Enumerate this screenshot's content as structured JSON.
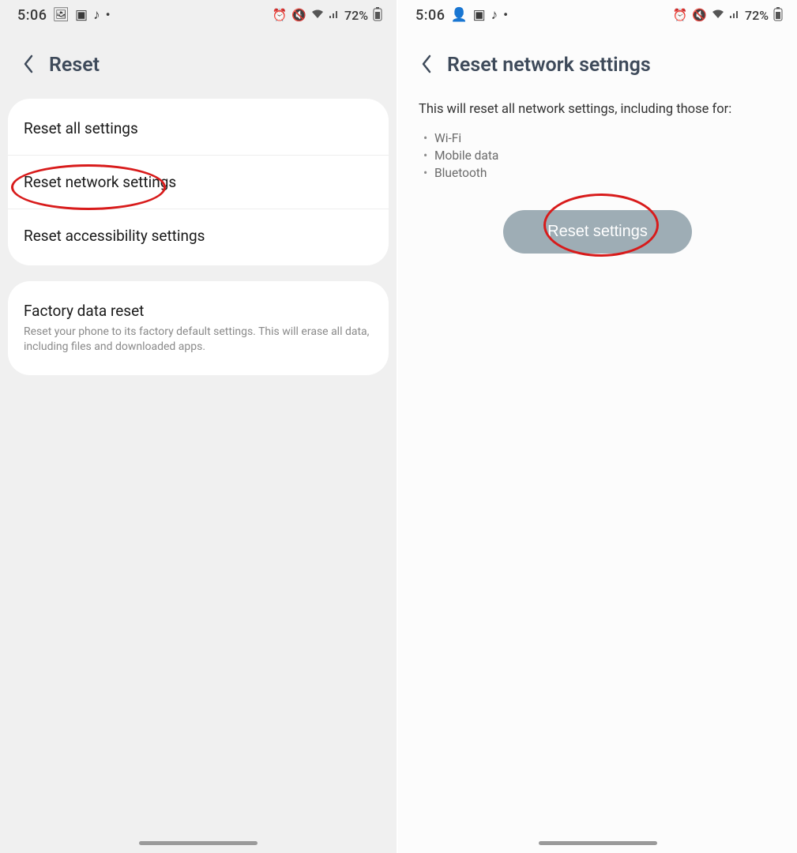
{
  "status": {
    "time": "5:06",
    "battery": "72%",
    "icons_left": [
      "image-icon",
      "apps-icon",
      "music-note-icon",
      "dot-icon"
    ],
    "icons_left_alt": [
      "profile-icon",
      "apps-icon",
      "music-note-icon",
      "dot-icon"
    ],
    "icons_right": [
      "alarm-icon",
      "mute-icon",
      "wifi-icon",
      "signal-icon"
    ]
  },
  "left": {
    "title": "Reset",
    "items": [
      {
        "label": "Reset all settings"
      },
      {
        "label": "Reset network settings"
      },
      {
        "label": "Reset accessibility settings"
      }
    ],
    "factory": {
      "label": "Factory data reset",
      "sub": "Reset your phone to its factory default settings. This will erase all data, including files and downloaded apps."
    }
  },
  "right": {
    "title": "Reset network settings",
    "intro": "This will reset all network settings, including those for:",
    "bullets": [
      "Wi-Fi",
      "Mobile data",
      "Bluetooth"
    ],
    "button": "Reset settings"
  }
}
